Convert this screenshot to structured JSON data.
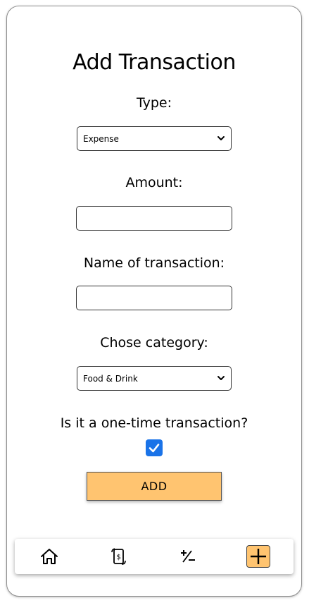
{
  "page": {
    "title": "Add Transaction"
  },
  "form": {
    "type_label": "Type:",
    "type_value": "Expense",
    "amount_label": "Amount:",
    "amount_value": "",
    "name_label": "Name of transaction:",
    "name_value": "",
    "category_label": "Chose category:",
    "category_value": "Food & Drink",
    "one_time_label": "Is it a one-time transaction?",
    "one_time_checked": true,
    "submit_label": "ADD"
  },
  "nav": {
    "items": [
      {
        "icon": "home-icon",
        "active": false
      },
      {
        "icon": "money-transfer-icon",
        "active": false
      },
      {
        "icon": "plus-minus-icon",
        "active": false
      },
      {
        "icon": "plus-icon",
        "active": true
      }
    ]
  },
  "colors": {
    "accent": "#ffc470",
    "checkbox": "#1a73e8"
  }
}
